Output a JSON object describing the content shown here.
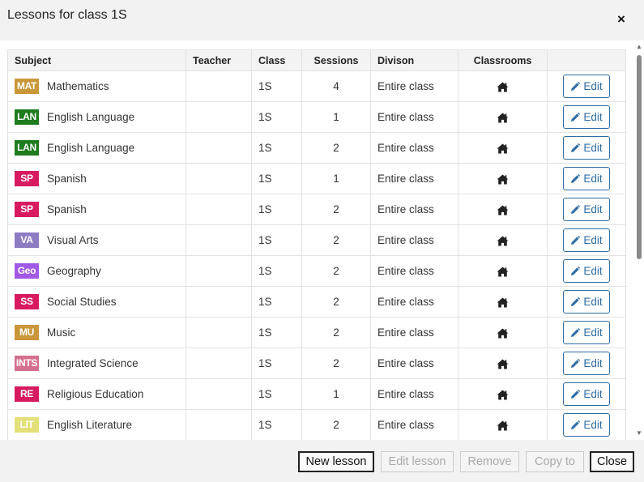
{
  "dialog": {
    "title": "Lessons for class 1S",
    "close_symbol": "×"
  },
  "table": {
    "headers": [
      "Subject",
      "Teacher",
      "Class",
      "Sessions",
      "Divison",
      "Classrooms",
      ""
    ],
    "edit_label": "Edit",
    "rows": [
      {
        "abbr": "MAT",
        "color": "#c9973a",
        "subject": "Mathematics",
        "teacher": "",
        "class": "1S",
        "sessions": "4",
        "division": "Entire class"
      },
      {
        "abbr": "LAN",
        "color": "#1e7b1e",
        "subject": "English Language",
        "teacher": "",
        "class": "1S",
        "sessions": "1",
        "division": "Entire class"
      },
      {
        "abbr": "LAN",
        "color": "#1e7b1e",
        "subject": "English Language",
        "teacher": "",
        "class": "1S",
        "sessions": "2",
        "division": "Entire class"
      },
      {
        "abbr": "SP",
        "color": "#d81b60",
        "subject": "Spanish",
        "teacher": "",
        "class": "1S",
        "sessions": "1",
        "division": "Entire class"
      },
      {
        "abbr": "SP",
        "color": "#d81b60",
        "subject": "Spanish",
        "teacher": "",
        "class": "1S",
        "sessions": "2",
        "division": "Entire class"
      },
      {
        "abbr": "VA",
        "color": "#8e7cc3",
        "subject": "Visual Arts",
        "teacher": "",
        "class": "1S",
        "sessions": "2",
        "division": "Entire class"
      },
      {
        "abbr": "Geo",
        "color": "#a259e6",
        "subject": "Geography",
        "teacher": "",
        "class": "1S",
        "sessions": "2",
        "division": "Entire class"
      },
      {
        "abbr": "SS",
        "color": "#d81b60",
        "subject": "Social Studies",
        "teacher": "",
        "class": "1S",
        "sessions": "2",
        "division": "Entire class"
      },
      {
        "abbr": "MU",
        "color": "#c9973a",
        "subject": "Music",
        "teacher": "",
        "class": "1S",
        "sessions": "2",
        "division": "Entire class"
      },
      {
        "abbr": "INTS",
        "color": "#d4708f",
        "subject": "Integrated Science",
        "teacher": "",
        "class": "1S",
        "sessions": "2",
        "division": "Entire class"
      },
      {
        "abbr": "RE",
        "color": "#d81b60",
        "subject": "Religious Education",
        "teacher": "",
        "class": "1S",
        "sessions": "1",
        "division": "Entire class"
      },
      {
        "abbr": "LIT",
        "color": "#e3e07a",
        "subject": "English Literature",
        "teacher": "",
        "class": "1S",
        "sessions": "2",
        "division": "Entire class"
      }
    ]
  },
  "footer": {
    "new_lesson": "New lesson",
    "edit_lesson": "Edit lesson",
    "remove": "Remove",
    "copy_to": "Copy to",
    "close": "Close"
  },
  "icons": {
    "classroom": "home-icon",
    "edit": "pencil-icon",
    "close": "close-icon"
  }
}
